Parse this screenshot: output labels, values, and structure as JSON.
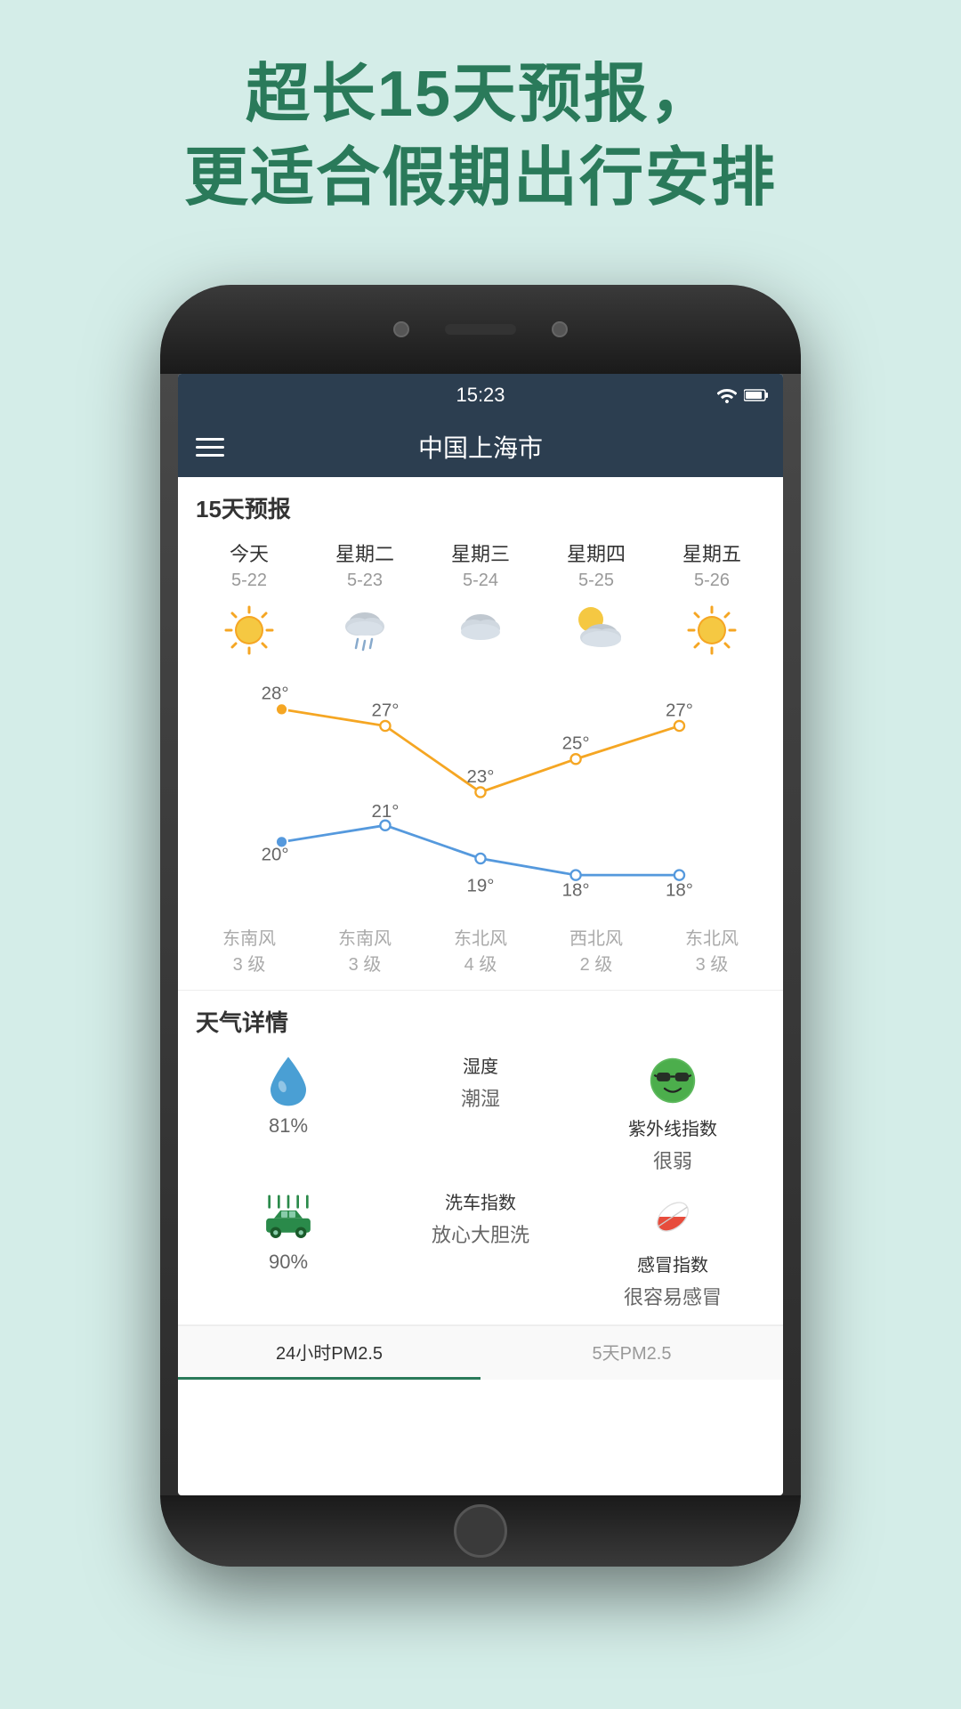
{
  "header": {
    "line1": "超长15天预报，",
    "line2": "更适合假期出行安排"
  },
  "status_bar": {
    "time": "15:23"
  },
  "app_header": {
    "title": "中国上海市"
  },
  "forecast": {
    "section_title": "15天预报",
    "days": [
      {
        "name": "今天",
        "date": "5-22",
        "icon": "sun",
        "high": "28°",
        "low": "20°",
        "wind_dir": "东南风",
        "wind_level": "3 级"
      },
      {
        "name": "星期二",
        "date": "5-23",
        "icon": "cloud-rain",
        "high": "27°",
        "low": "21°",
        "wind_dir": "东南风",
        "wind_level": "3 级"
      },
      {
        "name": "星期三",
        "date": "5-24",
        "icon": "cloud",
        "high": "23°",
        "low": "19°",
        "wind_dir": "东北风",
        "wind_level": "4 级"
      },
      {
        "name": "星期四",
        "date": "5-25",
        "icon": "partly-cloudy",
        "high": "25°",
        "low": "18°",
        "wind_dir": "西北风",
        "wind_level": "2 级"
      },
      {
        "name": "星期五",
        "date": "5-26",
        "icon": "sun",
        "high": "27°",
        "low": "18°",
        "wind_dir": "东北风",
        "wind_level": "3 级"
      }
    ]
  },
  "details": {
    "section_title": "天气详情",
    "items": [
      {
        "icon": "water-drop",
        "label": "",
        "value": "81%",
        "color": "#4a9fd4"
      },
      {
        "icon": "label-humidity",
        "label": "湿度",
        "value": "潮湿",
        "color": "#333"
      },
      {
        "icon": "sunglasses-emoji",
        "label": "紫外线指数",
        "value": "很弱",
        "color": "#333"
      },
      {
        "icon": "car-wash",
        "label": "",
        "value": "90%",
        "color": "#2a8a4a"
      },
      {
        "icon": "label-car-wash",
        "label": "洗车指数",
        "value": "放心大胆洗",
        "color": "#333"
      },
      {
        "icon": "pill",
        "label": "感冒指数",
        "value": "很容易感冒",
        "color": "#333"
      }
    ]
  },
  "bottom_tabs": [
    {
      "label": "24小时PM2.5",
      "active": true
    },
    {
      "label": "5天PM2.5",
      "active": false
    }
  ]
}
